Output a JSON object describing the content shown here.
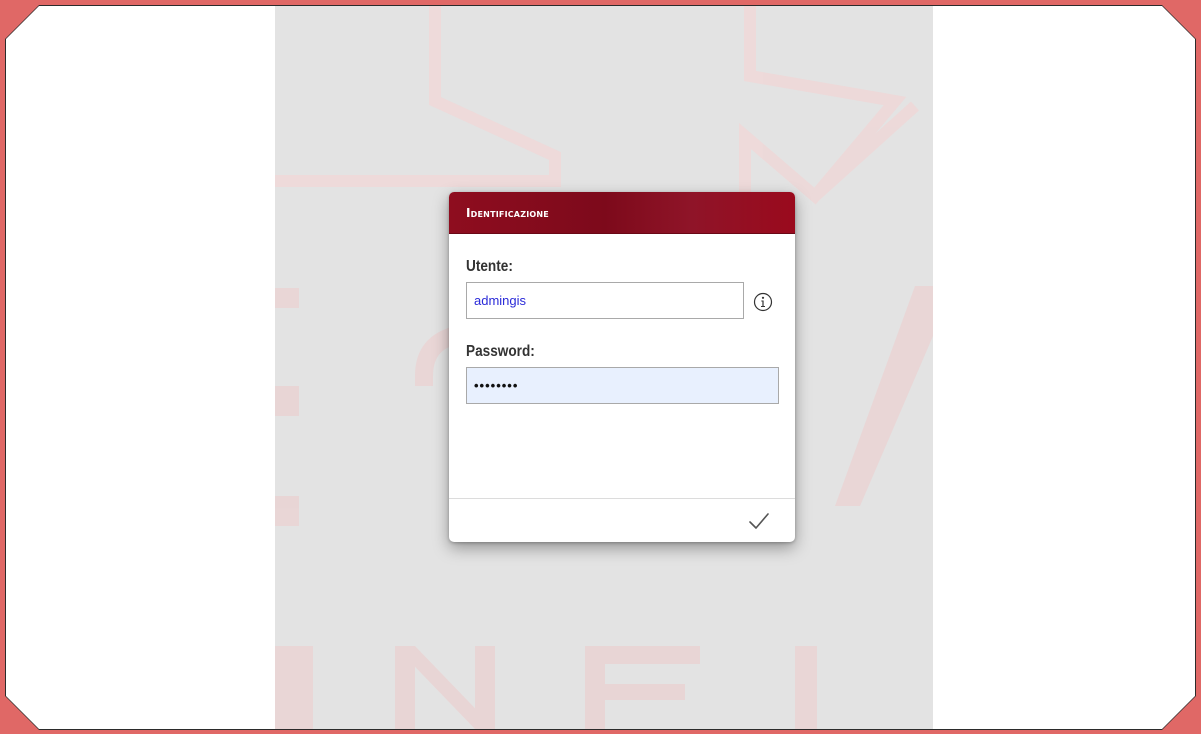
{
  "dialog": {
    "title": "Identificazione",
    "user_label": "Utente:",
    "user_value": "admingis",
    "password_label": "Password:",
    "password_value": "••••••••",
    "info_icon": "info-circle-icon",
    "confirm_icon": "checkmark-icon"
  },
  "colors": {
    "frame": "#e06866",
    "header": "#8e0d1f",
    "app_background": "#e3e3e3",
    "password_field_background": "#e8f0fe",
    "user_value_color": "#2a2ad8"
  }
}
